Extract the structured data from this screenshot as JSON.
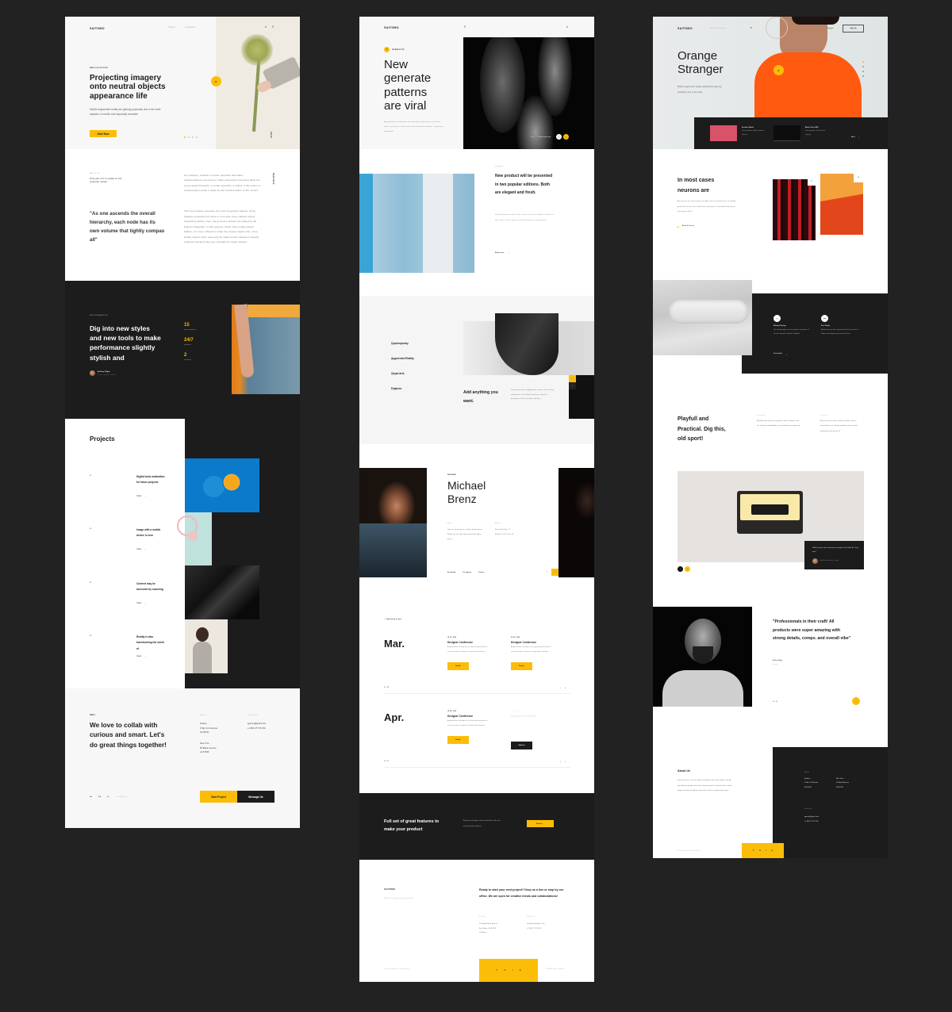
{
  "colors": {
    "accent": "#fbbd08",
    "dark": "#1c1c1c",
    "background": "#222222"
  },
  "col1": {
    "hero": {
      "logo": "SAITOMO",
      "nav": [
        "Twitter",
        "Instagram"
      ],
      "icons": [
        "search-icon",
        "menu-icon"
      ],
      "eyebrow": "NEW COLLECTION",
      "title": "Projecting imagery onto neutral objects appearance life",
      "text": "Mobile augmented reality are gaining popularity due to the wide adoption of mobile and especially wearable",
      "cta": "Start Now",
      "side_label": "Scroll",
      "play": "▸",
      "slides_total": 4,
      "slide_active": 1
    },
    "about": {
      "eyebrow": "ABOUT US",
      "intro": "Only part of it is visible on the computer screen.",
      "quote": "\"As one ascends the overall hierarchy, each node has its own volume that tightly compas all\"",
      "para1": "For example, consider a render operation that takes transformations into account: while recursively traversing down the scene graph hierarchy, a render operation is called. If the node is a transformation node, it adds its own transformation to the current.",
      "para2": "The tree's leaves represent the most foreground objects. Since drawing proceeds from back to front with closer objects simply overwriting farther ones, the process is known as employing the Painter's algorithm. In 3D systems, which often employ depth buffers, it is more efficient to draw the closest objects first, since farther objects often need only be depth-tested instead of actually rendered, because they are occluded by nearer objects.",
      "side_label": "Read more"
    },
    "stats": {
      "eyebrow": "NEW GENERATION",
      "title": "Dig into new styles and new tools to make performance slightly stylish and",
      "author": "Ashley Right",
      "author_role": "Trust creator studio",
      "items": [
        {
          "value": "15",
          "label": "new members"
        },
        {
          "value": "24/7",
          "label": "updates"
        },
        {
          "value": "2",
          "label": "products"
        }
      ]
    },
    "projects": {
      "title": "Projects",
      "items": [
        {
          "num": "01",
          "title": "Digital tools analization for future projects",
          "link": "View"
        },
        {
          "num": "02",
          "title": "Image with a mobile device is new.",
          "link": "View"
        },
        {
          "num": "03",
          "title": "Content may be accessed by scanning",
          "link": "View"
        },
        {
          "num": "04",
          "title": "Reality is also transforming the world of",
          "link": "View"
        }
      ]
    },
    "contact": {
      "eyebrow": "Hello,",
      "title": "We love to collab with curious and smart. Let's do great things together!",
      "offices_label": "Offices",
      "offices": [
        {
          "city": "Sydney →",
          "line1": "6 Sky Curl Avenue",
          "line2": "CA 90701"
        },
        {
          "city": "New York →",
          "line1": "65 Maple Avenue",
          "line2": "LA 87283"
        }
      ],
      "contact_label": "Contact Us",
      "email": "agency@gmail.com",
      "phone": "+1 800 277 672 84",
      "social": [
        "Tw",
        "Fb",
        "In"
      ],
      "social_extra": "— Follow us",
      "btn_primary": "Start Project",
      "btn_secondary": "Message Us"
    }
  },
  "col2": {
    "hero": {
      "logo": "SAITOMO",
      "eyebrow": "INTERACTIVE",
      "title": "New generate patterns are viral",
      "text": "Augmentation techniques are typically performed in real time and in semantic context with environmental elements. Immersive perceptual",
      "caption_prefix": "Next",
      "caption": "#Creativedesign",
      "prev": "‹",
      "next": "›"
    },
    "product": {
      "title": "New product will be presented in two popular editions. Both are elegant and fresh.",
      "text": "Startup founders often have a more casual or offbeat attitude in their dress, office space and marketing, as compared to",
      "link": "Shop now"
    },
    "features": {
      "menu": [
        {
          "label": "Contemporary",
          "sub": "Selection",
          "active": false
        },
        {
          "label": "Augmented Reality",
          "sub": "Selection",
          "active": true
        },
        {
          "label": "Visual Arts",
          "sub": "Selection",
          "active": false
        },
        {
          "label": "Features",
          "sub": "Selection",
          "active": false
        }
      ],
      "title": "Add anything you want.",
      "text": "The primary value of Augmented reality is that it brings components of the digital world into a person's perception of the real world, and does",
      "up": "›",
      "down": "‹"
    },
    "profile": {
      "eyebrow": "DESIGNER",
      "name": "Michael Brenz",
      "about_label": "About",
      "about": "Open to new projects, always professional. Sharp eye for style and passionate about music.",
      "awards_label": "Awards",
      "awards": [
        "Site of the Day '17",
        "Product of the Year '18"
      ],
      "social": [
        "Facebook",
        "Instagram",
        "Twitter"
      ],
      "prev": "‹",
      "next": "›"
    },
    "events": {
      "label": "— Upcoming events",
      "months": [
        {
          "month": "Mar.",
          "pager": "01 / 08",
          "events": [
            {
              "date": "18.03 / 2018",
              "title": "Designer Conference",
              "text": "Augmentation techniques are typically performed in real time and in semantic context with elements.",
              "btn": "Details",
              "sold": false,
              "faded": false
            },
            {
              "date": "18.03 / 2018",
              "title": "Designer Conference",
              "text": "Augmentation techniques are typically performed in real time and in semantic context with elements.",
              "btn": "Details",
              "sold": false,
              "faded": false
            }
          ]
        },
        {
          "month": "Apr.",
          "pager": "02 / 02",
          "events": [
            {
              "date": "18.04 / 2018",
              "title": "Designer Conference",
              "text": "Augmentation techniques are typically performed in real time and in semantic context with elements.",
              "btn": "Details",
              "sold": false,
              "faded": false
            },
            {
              "date": "18.04 / 2018",
              "title": "Designer Conference",
              "text": "",
              "btn": "Sold out",
              "sold": true,
              "faded": true
            }
          ]
        }
      ]
    },
    "banner": {
      "title": "Full set of great features to make your product",
      "text": "Explore and open new possibilities with our amazing new product",
      "btn": "Explore →"
    },
    "footer": {
      "logo": "SAITOMO",
      "tagline": "We do care about beauty and stuff",
      "headline": "Ready to start your next project? Drop us a line or stop by our office. We are open for creative minds and collaborations!",
      "visit_label": "Visit Us",
      "address": [
        "28 Independent Avenue",
        "San Pedro, CA 90731",
        "California"
      ],
      "contact_label": "Contact Us",
      "email": "hellagency@gmail.com",
      "phone": "+1 800 277 672 84",
      "legal": "Terms & Conditions / Privacy policy",
      "copyright": "©2018 All rights reserved",
      "social": [
        "twitter-icon",
        "google-icon",
        "facebook-icon",
        "instagram-icon"
      ],
      "social_glyphs": [
        "✦",
        "G",
        "f",
        "◎"
      ]
    }
  },
  "col3": {
    "hero": {
      "logo": "SAITOMO",
      "search_placeholder": "Search by keyword",
      "login": "Log In",
      "signup": "Sign Up",
      "title": "Orange Stranger",
      "text": "Mobile augmented reality applications gaining popularity due to the wide",
      "cards": [
        {
          "title": "Fashion Mode",
          "text": "Latest updates design interface industry"
        },
        {
          "title": "Black Soul DSF",
          "text": "Latest updates from fashion industry"
        }
      ],
      "more": "More"
    },
    "neurons": {
      "title": "In most cases neurons are",
      "text": "All neurons are electrically excitable, due to maintenance of voltage gradients across their membranes by means of metabolically driven ion pumps, which",
      "link": "Read all stories",
      "tag1": "01",
      "tag2": "02"
    },
    "design": {
      "items": [
        {
          "icon": "headphones-icon",
          "glyph": "∩",
          "title": "Minimal Design",
          "text": "The disadvantages are the physical constraints of the user having to hold the handheld"
        },
        {
          "icon": "link-icon",
          "glyph": "⚯",
          "title": "Fast Reply",
          "text": "Additional tests show high potential for be used as a display technology for patients that have"
        }
      ],
      "link": "View details"
    },
    "playful": {
      "title": "Playfull and Practical. Dig this, old sport!",
      "col1_label": "Our mission",
      "col1": "Metabolically driven ion pumps, which combine with ion channels embedded in the membrane to generate",
      "col2_label": "Our vision",
      "col2": "All neurons are electrically excitable, due to maintenance of voltage gradients across their membranes by means of",
      "quote": "\"While several color and wear test samples of the Nike Air 'Yang were'\"",
      "quote_author": "Ashley Richardson, Design"
    },
    "testimonial": {
      "quote": "\"Professionals in their craft! All products were super amazing with strong details, comps. and overall vibe\"",
      "author": "Ashley Right",
      "role": "Founder",
      "pager": "01 / 08",
      "next": "›"
    },
    "footer": {
      "about_title": "About Us",
      "about_text": "Site Generator is set of useful templates with fresh layouts. Build specially for people who have strong need to represent their works simple and beautifully but they don't want to spend much time.",
      "copyright": "All right reserved. ©2018 Generator",
      "offices_label": "Offices",
      "offices": [
        {
          "city": "Sydney →",
          "line1": "6 Sky Curl Avenue",
          "line2": "CA 90701"
        },
        {
          "city": "New York →",
          "line1": "65 Maple Avenue",
          "line2": "LA 87283"
        }
      ],
      "contact_label": "Contact Us",
      "email": "agency@gmail.com",
      "phone": "+1 800 277 672 84",
      "social": [
        "twitter-icon",
        "google-icon",
        "facebook-icon",
        "instagram-icon"
      ],
      "social_glyphs": [
        "✦",
        "G",
        "f",
        "◎"
      ]
    }
  }
}
